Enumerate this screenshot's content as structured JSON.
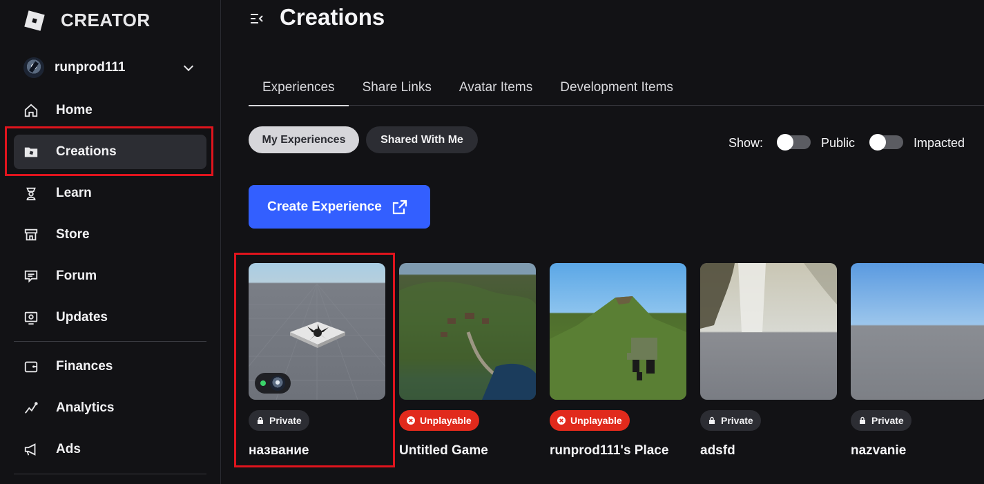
{
  "app": {
    "logo_text": "CREATOR"
  },
  "account": {
    "name": "runprod111"
  },
  "sidebar": {
    "items": [
      {
        "label": "Home",
        "icon": "home-icon"
      },
      {
        "label": "Creations",
        "icon": "folder-icon",
        "active": true
      },
      {
        "label": "Learn",
        "icon": "learn-icon"
      },
      {
        "label": "Store",
        "icon": "store-icon"
      },
      {
        "label": "Forum",
        "icon": "forum-icon"
      },
      {
        "label": "Updates",
        "icon": "updates-icon"
      },
      {
        "label": "Finances",
        "icon": "wallet-icon"
      },
      {
        "label": "Analytics",
        "icon": "analytics-icon"
      },
      {
        "label": "Ads",
        "icon": "megaphone-icon"
      }
    ]
  },
  "header": {
    "title": "Creations"
  },
  "tabs": [
    {
      "label": "Experiences",
      "active": true
    },
    {
      "label": "Share Links"
    },
    {
      "label": "Avatar Items"
    },
    {
      "label": "Development Items"
    }
  ],
  "filters": {
    "my_experiences": "My Experiences",
    "shared_with_me": "Shared With Me",
    "show_label": "Show:",
    "public_label": "Public",
    "impacted_label": "Impacted",
    "public_on": false,
    "impacted_on": false
  },
  "create_button": {
    "label": "Create Experience"
  },
  "experiences": [
    {
      "title": "название",
      "status": "Private",
      "status_type": "private"
    },
    {
      "title": "Untitled Game",
      "status": "Unplayable",
      "status_type": "unplayable"
    },
    {
      "title": "runprod111's Place",
      "status": "Unplayable",
      "status_type": "unplayable"
    },
    {
      "title": "adsfd",
      "status": "Private",
      "status_type": "private"
    },
    {
      "title": "nazvanie",
      "status": "Private",
      "status_type": "private"
    }
  ],
  "colors": {
    "background": "#121215",
    "accent_blue": "#335fff",
    "highlight_red": "#e0141d",
    "unplayable_red": "#e12a1c",
    "online_green": "#3bd46a"
  }
}
